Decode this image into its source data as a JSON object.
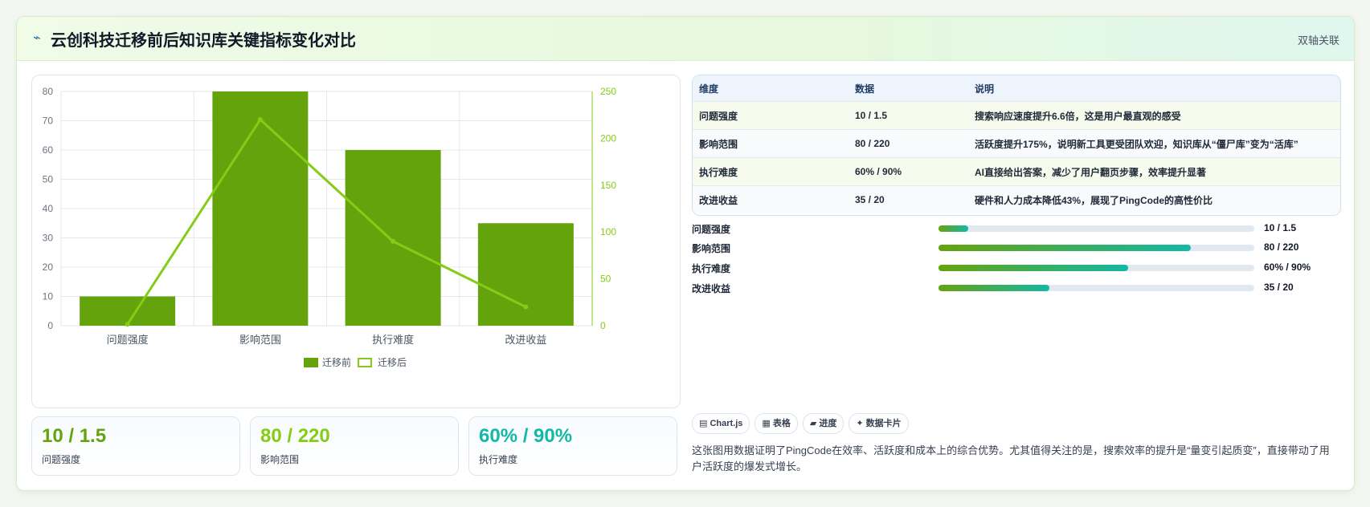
{
  "header": {
    "title": "云创科技迁移前后知识库关键指标变化对比",
    "tag": "双轴关联",
    "bolt": "⌁"
  },
  "chart_data": {
    "type": "bar",
    "categories": [
      "问题强度",
      "影响范围",
      "执行难度",
      "改进收益"
    ],
    "series": [
      {
        "name": "迁移前",
        "type": "bar",
        "axis": "left",
        "values": [
          10,
          80,
          60,
          35
        ],
        "color": "#65a30d"
      },
      {
        "name": "迁移后",
        "type": "line",
        "axis": "right",
        "values": [
          1.5,
          220,
          90,
          20
        ],
        "color": "#84cc16"
      }
    ],
    "y_left": {
      "ylim": [
        0,
        80
      ],
      "ticks": [
        "0",
        "10",
        "20",
        "30",
        "40",
        "50",
        "60",
        "70",
        "80"
      ]
    },
    "y_right": {
      "ylim": [
        0,
        250
      ],
      "ticks": [
        "0",
        "50",
        "100",
        "150",
        "200",
        "250"
      ]
    },
    "grid": true,
    "legend_position": "bottom"
  },
  "kpis": [
    {
      "value": "10 / 1.5",
      "label": "问题强度",
      "color": "#65a30d"
    },
    {
      "value": "80 / 220",
      "label": "影响范围",
      "color": "#84cc16"
    },
    {
      "value": "60% / 90%",
      "label": "执行难度",
      "color": "#14b8a6"
    }
  ],
  "table": {
    "headers": [
      "维度",
      "数据",
      "说明"
    ],
    "rows": [
      [
        "问题强度",
        "10 / 1.5",
        "搜索响应速度提升6.6倍，这是用户最直观的感受"
      ],
      [
        "影响范围",
        "80 / 220",
        "活跃度提升175%，说明新工具更受团队欢迎，知识库从“僵尸库”变为“活库”"
      ],
      [
        "执行难度",
        "60% / 90%",
        "AI直接给出答案，减少了用户翻页步骤，效率提升显著"
      ],
      [
        "改进收益",
        "35 / 20",
        "硬件和人力成本降低43%，展现了PingCode的高性价比"
      ]
    ]
  },
  "progress": [
    {
      "label": "问题强度",
      "value": "10 / 1.5",
      "fraction": 0.095
    },
    {
      "label": "影响范围",
      "value": "80 / 220",
      "fraction": 0.8
    },
    {
      "label": "执行难度",
      "value": "60% / 90%",
      "fraction": 0.6
    },
    {
      "label": "改进收益",
      "value": "35 / 20",
      "fraction": 0.35
    }
  ],
  "chips": [
    "▤ Chart.js",
    "▦ 表格",
    "▰ 进度",
    "✦ 数据卡片"
  ],
  "summary": "这张图用数据证明了PingCode在效率、活跃度和成本上的综合优势。尤其值得关注的是，搜索效率的提升是“量变引起质变”，直接带动了用户活跃度的爆发式增长。"
}
